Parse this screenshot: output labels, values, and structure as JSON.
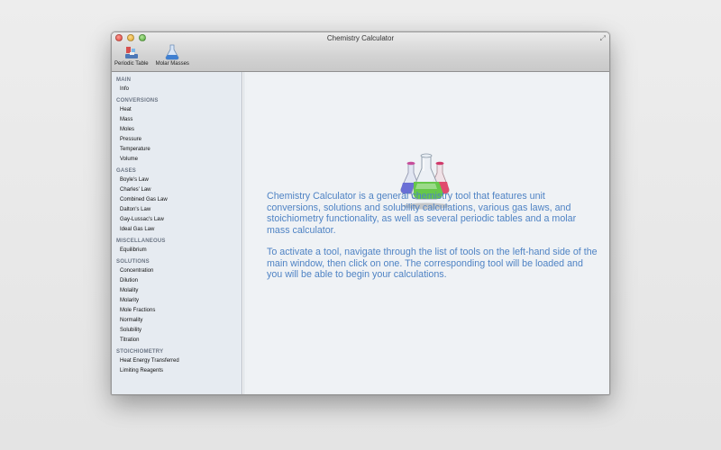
{
  "window": {
    "title": "Chemistry Calculator"
  },
  "toolbar": {
    "items": [
      {
        "label": "Periodic Table",
        "icon": "periodic-table-icon"
      },
      {
        "label": "Molar Masses",
        "icon": "flask-icon"
      }
    ]
  },
  "sidebar": {
    "sections": [
      {
        "header": "MAIN",
        "items": [
          "Info"
        ]
      },
      {
        "header": "CONVERSIONS",
        "items": [
          "Heat",
          "Mass",
          "Moles",
          "Pressure",
          "Temperature",
          "Volume"
        ]
      },
      {
        "header": "GASES",
        "items": [
          "Boyle's Law",
          "Charles' Law",
          "Combined Gas Law",
          "Dalton's Law",
          "Gay-Lussac's Law",
          "Ideal Gas Law"
        ]
      },
      {
        "header": "MISCELLANEOUS",
        "items": [
          "Equilibrium"
        ]
      },
      {
        "header": "SOLUTIONS",
        "items": [
          "Concentration",
          "Dilution",
          "Molality",
          "Molarity",
          "Mole Fractions",
          "Normality",
          "Solubility",
          "Titration"
        ]
      },
      {
        "header": "STOICHIOMETRY",
        "items": [
          "Heat Energy Transferred",
          "Limiting Reagents"
        ]
      }
    ]
  },
  "main": {
    "paragraph1": "Chemistry Calculator is a general chemistry tool that features unit conversions, solutions and solubility calculations, various gas laws, and stoichiometry functionality, as well as several periodic tables and a molar mass calculator.",
    "paragraph2": "To activate a tool, navigate through the list of tools on the left-hand side of the main window, then click on one. The corresponding tool will be loaded and you will be able to begin your calculations."
  },
  "colors": {
    "description_text": "#4f83c4",
    "sidebar_bg": "#e6ebf1",
    "section_header": "#6c7685"
  }
}
